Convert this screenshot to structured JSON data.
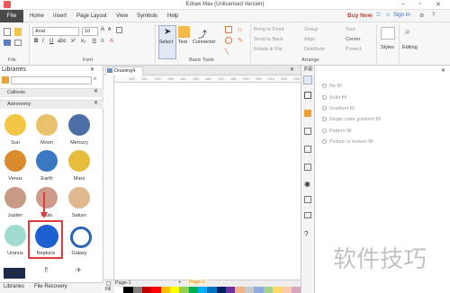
{
  "window": {
    "title": "Edraw Max (Unlicensed Version)"
  },
  "menu": {
    "file": "File",
    "items": [
      "Home",
      "Insert",
      "Page Layout",
      "View",
      "Symbols",
      "Help"
    ],
    "buy_now": "Buy Now",
    "sign_in": "Sign In"
  },
  "ribbon": {
    "font_name": "Arial",
    "font_size": "10",
    "groups": {
      "file": "File",
      "font": "Font",
      "basic_tools": "Basic Tools",
      "arrange": "Arrange"
    },
    "tools": {
      "select": "Select",
      "text": "Text",
      "connector": "Connector"
    },
    "arrange": {
      "bring_front": "Bring to Front",
      "send_back": "Send to Back",
      "rotate_flip": "Rotate & Flip",
      "group": "Group",
      "align": "Align",
      "distribute": "Distribute",
      "size": "Size",
      "center": "Center",
      "protect": "Protect"
    },
    "styles": "Styles",
    "editing": "Editing"
  },
  "libraries": {
    "title": "Libraries",
    "categories": [
      "Callouts",
      "Astronomy"
    ],
    "symbols": [
      "Sun",
      "Moon",
      "Mercury",
      "Venus",
      "Earth",
      "Mars",
      "Jupiter",
      "Pluto",
      "Saturn",
      "Uranus",
      "Neptune",
      "Galaxy"
    ],
    "tabs": [
      "Libraries",
      "File Recovery"
    ]
  },
  "document": {
    "tab": "Drawing4",
    "ruler": [
      "100",
      "110",
      "120",
      "130",
      "140",
      "150",
      "160",
      "170",
      "180",
      "190",
      "200",
      "210",
      "220",
      "230"
    ]
  },
  "pages": {
    "current": "Page-1",
    "tab": "Page-1",
    "fill_label": "Fill"
  },
  "fill_panel": {
    "title": "Fill",
    "options": [
      "No fill",
      "Solid fill",
      "Gradient fill",
      "Single color gradient fill",
      "Pattern fill",
      "Picture or texture fill"
    ]
  },
  "watermark": "软件技巧"
}
